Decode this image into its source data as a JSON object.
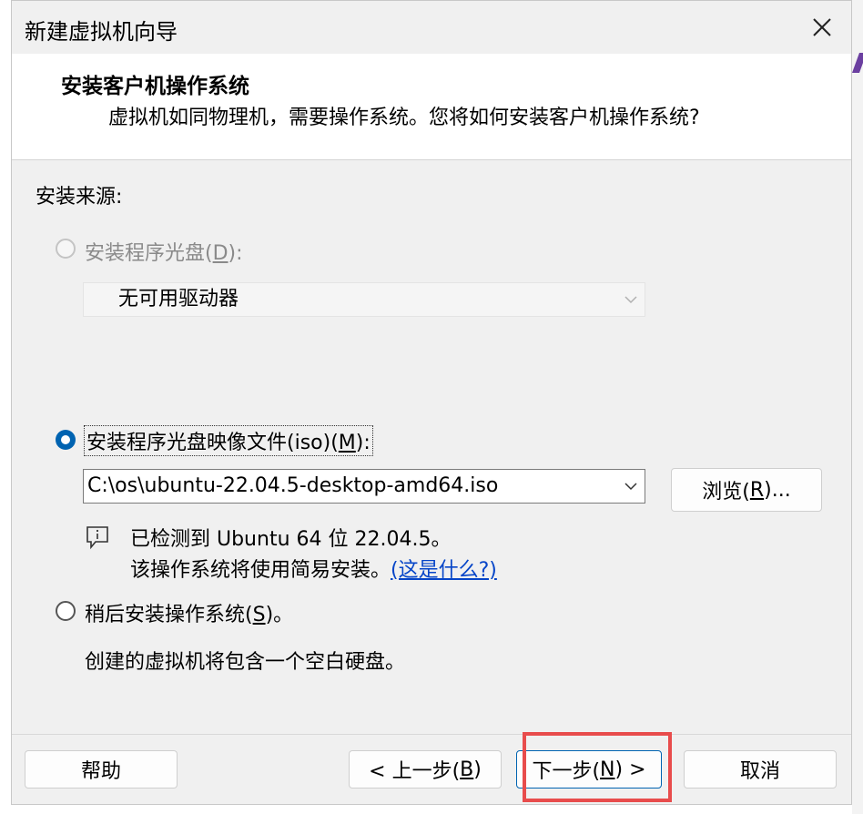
{
  "window": {
    "title": "新建虚拟机向导",
    "close_icon": "close-icon"
  },
  "header": {
    "title": "安装客户机操作系统",
    "subtitle": "虚拟机如同物理机，需要操作系统。您将如何安装客户机操作系统?"
  },
  "install_source": {
    "label": "安装来源:",
    "options": {
      "disc": {
        "label_prefix": "安装程序光盘(",
        "accel": "D",
        "label_suffix": "):",
        "selected": false,
        "enabled": false,
        "drive_value": "无可用驱动器"
      },
      "iso": {
        "label_prefix": "安装程序光盘映像文件(iso)(",
        "accel": "M",
        "label_suffix": "):",
        "selected": true,
        "path_value": "C:\\os\\ubuntu-22.04.5-desktop-amd64.iso",
        "browse_prefix": "浏览(",
        "browse_accel": "R",
        "browse_suffix": ")...",
        "detect_line": "已检测到 Ubuntu 64 位 22.04.5。",
        "easy_install_text": "该操作系统将使用简易安装。",
        "whats_this_link": "(这是什么?)"
      },
      "later": {
        "label_prefix": "稍后安装操作系统(",
        "accel": "S",
        "label_suffix": ")。",
        "selected": false,
        "description": "创建的虚拟机将包含一个空白硬盘。"
      }
    }
  },
  "footer": {
    "help": "帮助",
    "back_prefix": "< 上一步(",
    "back_accel": "B",
    "back_suffix": ")",
    "next_prefix": "下一步(",
    "next_accel": "N",
    "next_suffix": ") >",
    "cancel": "取消"
  },
  "colors": {
    "accent": "#0063b1",
    "highlight_box": "#e84c4c",
    "link": "#0645c8"
  }
}
